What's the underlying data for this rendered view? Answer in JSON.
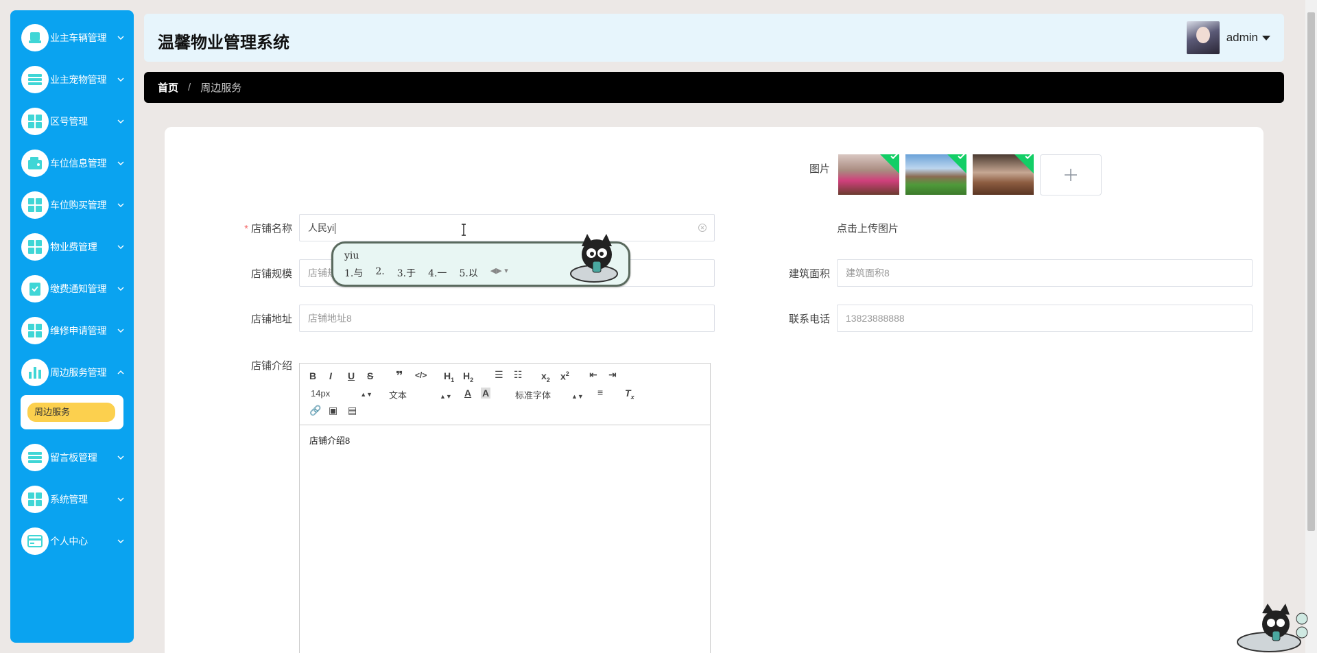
{
  "app": {
    "title": "温馨物业管理系统"
  },
  "user": {
    "name": "admin"
  },
  "sidebar": {
    "items": [
      {
        "label": "业主车辆管理",
        "icon": "car-icon"
      },
      {
        "label": "业主宠物管理",
        "icon": "list-icon"
      },
      {
        "label": "区号管理",
        "icon": "grid-icon"
      },
      {
        "label": "车位信息管理",
        "icon": "wallet-icon"
      },
      {
        "label": "车位购买管理",
        "icon": "grid-icon"
      },
      {
        "label": "物业费管理",
        "icon": "grid-icon"
      },
      {
        "label": "缴费通知管理",
        "icon": "clipboard-check-icon"
      },
      {
        "label": "维修申请管理",
        "icon": "grid-icon"
      },
      {
        "label": "周边服务管理",
        "icon": "bar-chart-icon"
      },
      {
        "label": "留言板管理",
        "icon": "list-icon"
      },
      {
        "label": "系统管理",
        "icon": "grid-icon"
      },
      {
        "label": "个人中心",
        "icon": "card-icon"
      }
    ],
    "submenu": {
      "label": "周边服务"
    }
  },
  "breadcrumb": {
    "home": "首页",
    "separator": "/",
    "current": "周边服务"
  },
  "form": {
    "image_label": "图片",
    "upload_hint": "点击上传图片",
    "name_label": "店铺名称",
    "name_value": "人民yi",
    "scale_label": "店铺规模",
    "scale_placeholder": "店铺规模8",
    "area_label": "建筑面积",
    "area_placeholder": "建筑面积8",
    "address_label": "店铺地址",
    "address_placeholder": "店铺地址8",
    "phone_label": "联系电话",
    "phone_placeholder": "13823888888",
    "intro_label": "店铺介绍",
    "intro_content": "店铺介绍8"
  },
  "editor": {
    "font_size": "14px",
    "text_type": "文本",
    "font_family": "标准字体"
  },
  "ime": {
    "composition": "yiu",
    "candidates": [
      "1.与",
      "2.",
      "3.于",
      "4.一",
      "5.以"
    ]
  },
  "colors": {
    "sidebar": "#0aa3f0",
    "header": "#e7f5fc",
    "breadcrumb": "#000000",
    "active_submenu": "#fcd04e"
  }
}
